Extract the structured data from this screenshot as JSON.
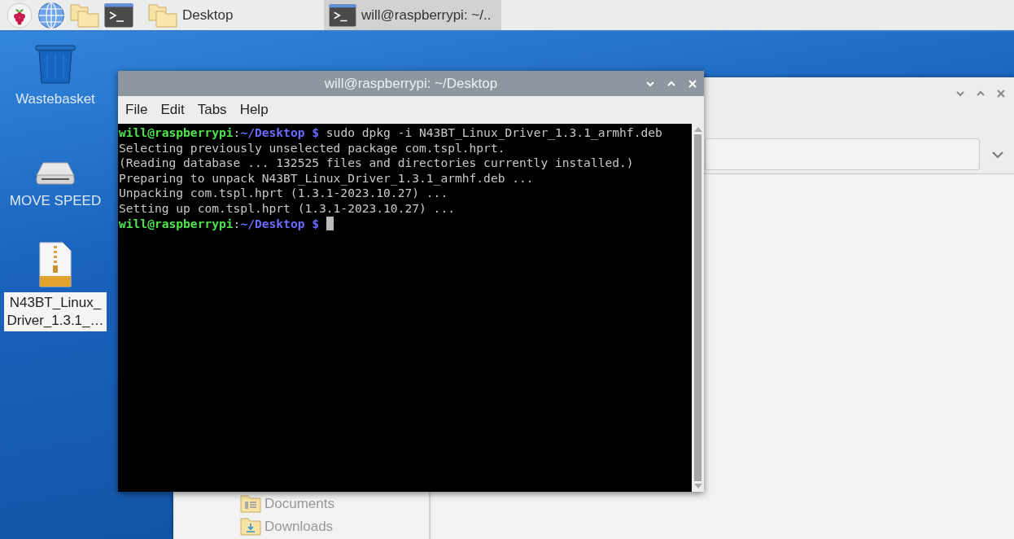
{
  "taskbar": {
    "tasks": [
      {
        "kind": "folder",
        "label": "Desktop",
        "selected": false
      },
      {
        "kind": "terminal",
        "label": "will@raspberrypi: ~/..",
        "selected": true
      }
    ]
  },
  "desktop_icons": [
    {
      "kind": "trash",
      "lines": [
        "Wastebasket"
      ],
      "selected": false
    },
    {
      "kind": "drive",
      "lines": [
        "MOVE SPEED"
      ],
      "selected": false
    },
    {
      "kind": "archive",
      "lines": [
        "N43BT_Linux_",
        "Driver_1.3.1_…"
      ],
      "selected": true
    }
  ],
  "file_manager": {
    "sidebar": {
      "items": [
        {
          "kind": "documents",
          "label": "Documents"
        },
        {
          "kind": "downloads",
          "label": "Downloads"
        }
      ]
    }
  },
  "terminal": {
    "title": "will@raspberrypi: ~/Desktop",
    "menu": [
      "File",
      "Edit",
      "Tabs",
      "Help"
    ],
    "lines": [
      {
        "kind": "prompt",
        "user": "will@raspberrypi",
        "separator": ":",
        "path": "~/Desktop $",
        "command": "sudo dpkg -i N43BT_Linux_Driver_1.3.1_armhf.deb",
        "cursor": false
      },
      {
        "kind": "output",
        "text": "Selecting previously unselected package com.tspl.hprt."
      },
      {
        "kind": "output",
        "text": "(Reading database ... 132525 files and directories currently installed.)"
      },
      {
        "kind": "output",
        "text": "Preparing to unpack N43BT_Linux_Driver_1.3.1_armhf.deb ..."
      },
      {
        "kind": "output",
        "text": "Unpacking com.tspl.hprt (1.3.1-2023.10.27) ..."
      },
      {
        "kind": "output",
        "text": "Setting up com.tspl.hprt (1.3.1-2023.10.27) ..."
      },
      {
        "kind": "prompt",
        "user": "will@raspberrypi",
        "separator": ":",
        "path": "~/Desktop $",
        "cursor": true
      }
    ]
  }
}
